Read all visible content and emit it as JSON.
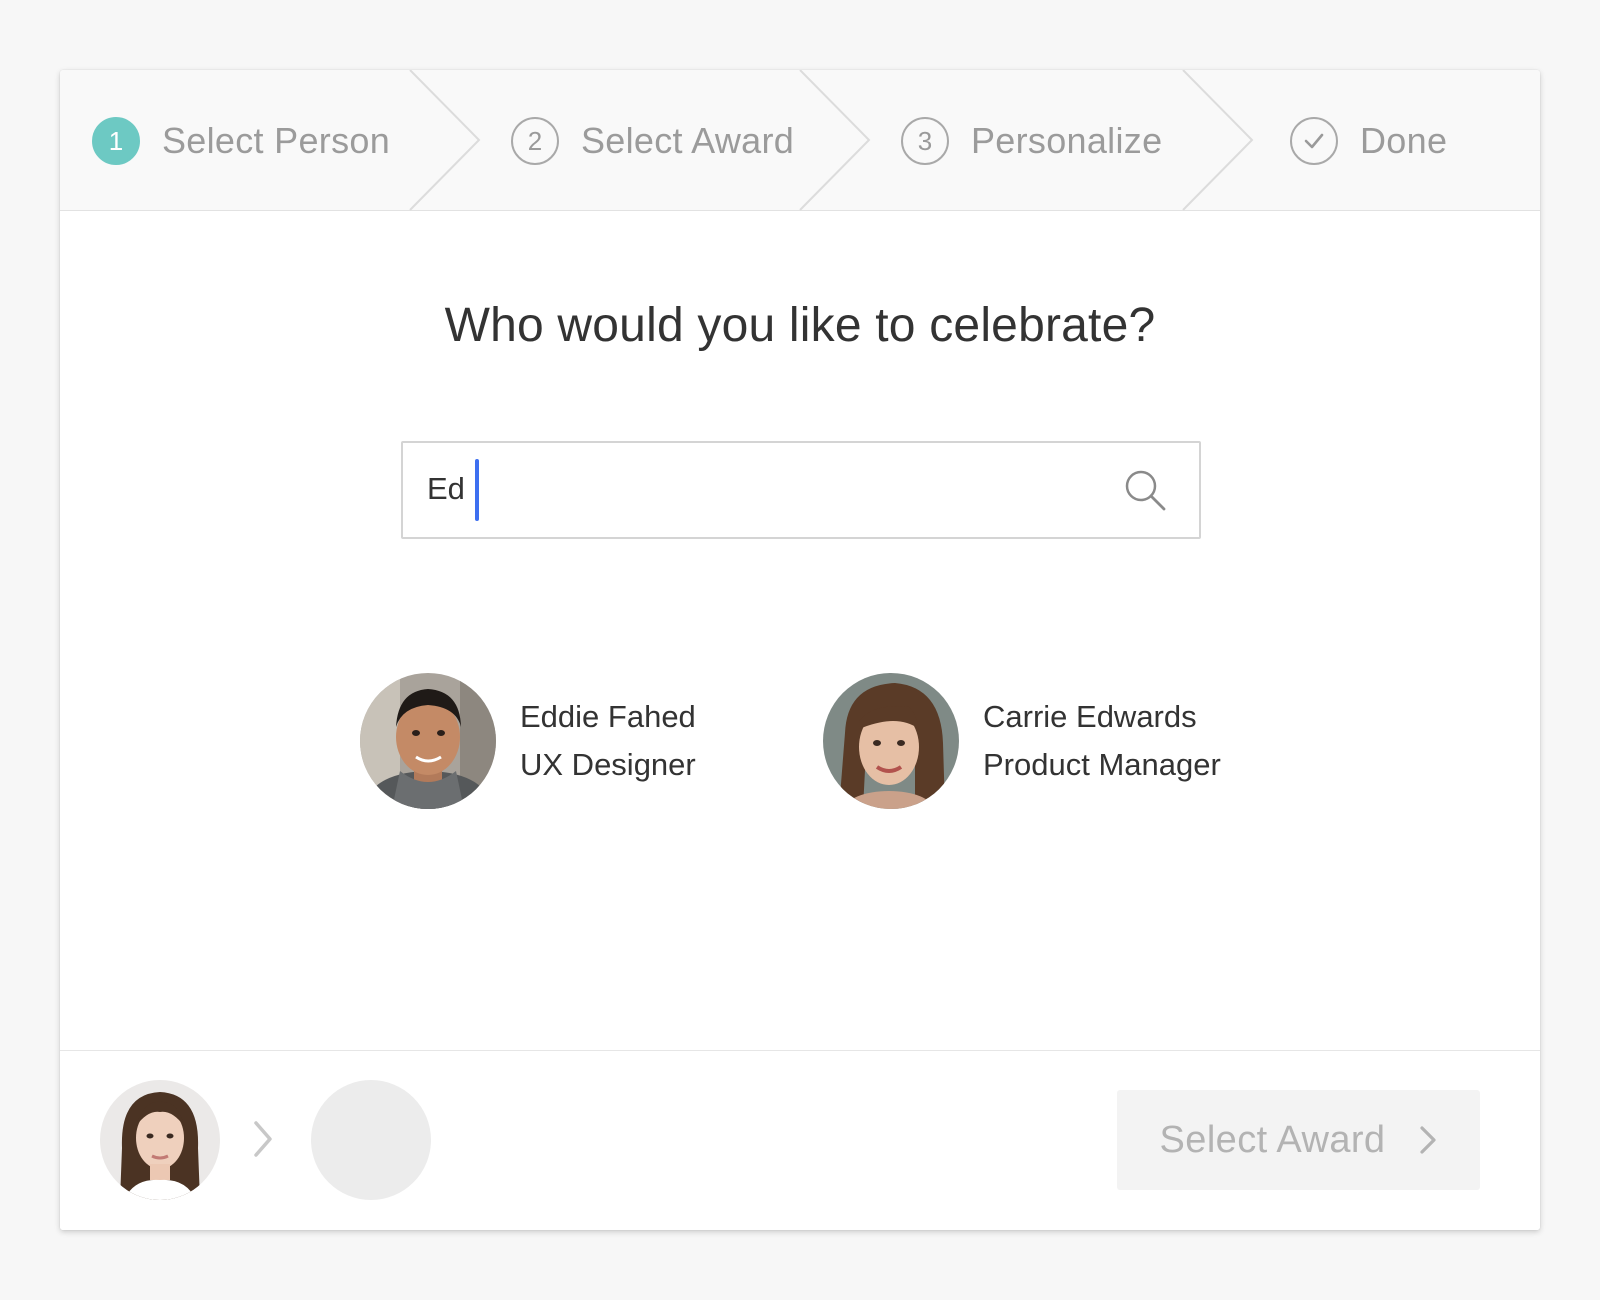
{
  "stepper": {
    "steps": [
      {
        "number": "1",
        "label": "Select Person",
        "state": "active"
      },
      {
        "number": "2",
        "label": "Select Award",
        "state": "pending"
      },
      {
        "number": "3",
        "label": "Personalize",
        "state": "pending"
      },
      {
        "number": "",
        "label": "Done",
        "state": "pending",
        "icon": "check-circle-icon"
      }
    ],
    "active_color": "#6dc9c3"
  },
  "main": {
    "heading": "Who would you like to celebrate?",
    "search": {
      "value": "Ed",
      "icon": "search-icon"
    },
    "results": [
      {
        "name": "Eddie Fahed",
        "role": "UX Designer"
      },
      {
        "name": "Carrie Edwards",
        "role": "Product Manager"
      }
    ]
  },
  "footer": {
    "next_button_label": "Select Award",
    "caret_color": "#3d6ff0"
  }
}
